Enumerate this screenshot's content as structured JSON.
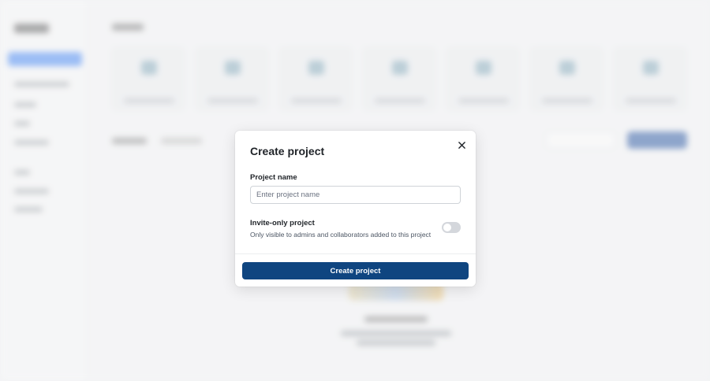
{
  "modal": {
    "title": "Create project",
    "project_name_label": "Project name",
    "project_name_placeholder": "Enter project name",
    "project_name_value": "",
    "invite_only_title": "Invite-only project",
    "invite_only_description": "Only visible to admins and collaborators added to this project",
    "invite_only_enabled": false,
    "submit_label": "Create project",
    "close_icon": "close-icon"
  },
  "colors": {
    "primary_button": "#0f4580",
    "toggle_off": "#d4d7dc"
  }
}
